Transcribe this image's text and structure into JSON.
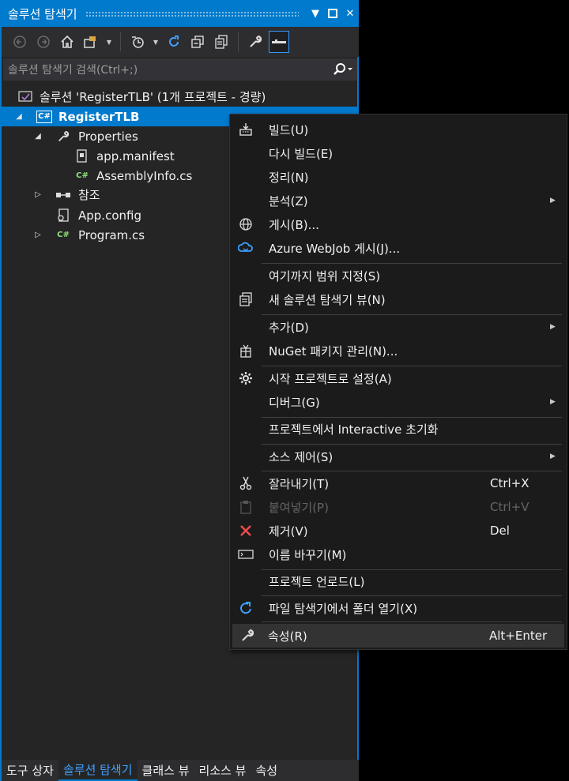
{
  "window": {
    "title": "솔루션 탐색기",
    "buttons": {
      "dropdown": "▼",
      "maximize": "▢",
      "close": "✕"
    }
  },
  "search": {
    "placeholder": "솔루션 탐색기 검색(Ctrl+;)"
  },
  "tree": {
    "solution": "솔루션 'RegisterTLB' (1개 프로젝트 - 경량)",
    "project": "RegisterTLB",
    "project_icon": "C#",
    "properties": "Properties",
    "manifest": "app.manifest",
    "assemblyinfo": "AssemblyInfo.cs",
    "references": "참조",
    "appconfig": "App.config",
    "program": "Program.cs",
    "cs_badge": "C#"
  },
  "menu": {
    "build": "빌드(U)",
    "rebuild": "다시 빌드(E)",
    "clean": "정리(N)",
    "analyze": "분석(Z)",
    "publish": "게시(B)...",
    "azure": "Azure WebJob 게시(J)...",
    "scope": "여기까지 범위 지정(S)",
    "new_view": "새 솔루션 탐색기 뷰(N)",
    "add": "추가(D)",
    "nuget": "NuGet 패키지 관리(N)...",
    "startup": "시작 프로젝트로 설정(A)",
    "debug": "디버그(G)",
    "interactive": "프로젝트에서 Interactive 초기화",
    "source": "소스 제어(S)",
    "cut": "잘라내기(T)",
    "cut_sc": "Ctrl+X",
    "paste": "붙여넣기(P)",
    "paste_sc": "Ctrl+V",
    "remove": "제거(V)",
    "remove_sc": "Del",
    "rename": "이름 바꾸기(M)",
    "unload": "프로젝트 언로드(L)",
    "open_folder": "파일 탐색기에서 폴더 열기(X)",
    "properties": "속성(R)",
    "properties_sc": "Alt+Enter"
  },
  "tabs": {
    "toolbox": "도구 상자",
    "solution_explorer": "솔루션 탐색기",
    "class_view": "클래스 뷰",
    "resource_view": "리소스 뷰",
    "properties": "속성"
  },
  "colors": {
    "accent": "#007acc",
    "panel": "#252526",
    "menu": "#1b1b1c",
    "remove_icon": "#f14c4c"
  },
  "icons": [
    "back-icon",
    "forward-icon",
    "home-icon",
    "switch-views-icon",
    "pending-changes-icon",
    "sync-icon",
    "collapse-all-icon",
    "show-all-files-icon",
    "wrench-icon",
    "preview-icon",
    "search-icon",
    "build-icon",
    "publish-icon",
    "azure-icon",
    "new-view-icon",
    "nuget-icon",
    "gear-icon",
    "scissors-icon",
    "paste-icon",
    "remove-icon",
    "rename-icon",
    "open-folder-icon"
  ]
}
